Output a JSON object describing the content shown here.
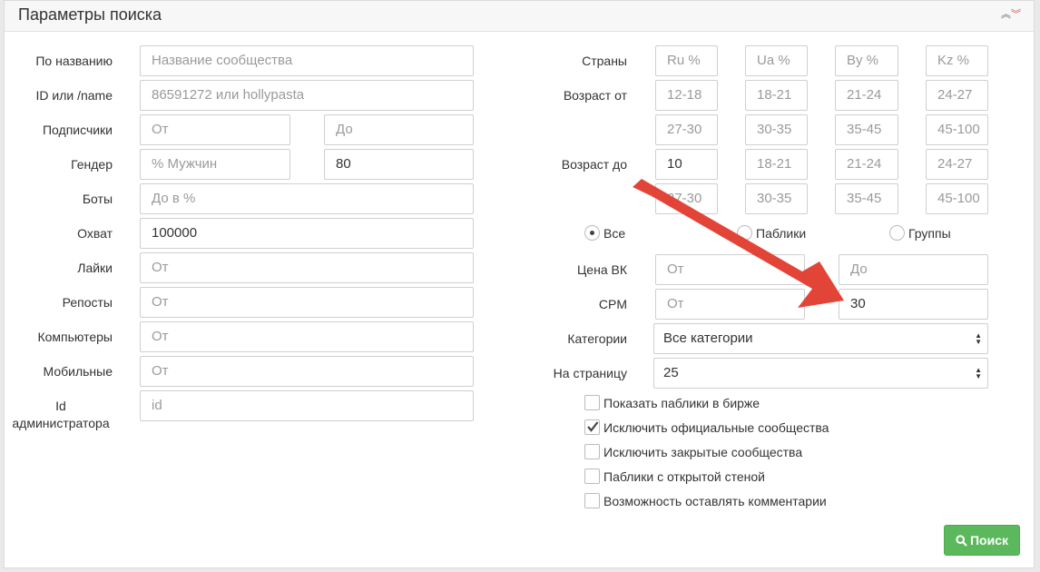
{
  "panel": {
    "title": "Параметры поиска"
  },
  "left": {
    "name_label": "По названию",
    "name_placeholder": "Название сообщества",
    "id_label": "ID или /name",
    "id_placeholder": "86591272 или hollypasta",
    "subs_label": "Подписчики",
    "subs_from": "От",
    "subs_to": "До",
    "gender_label": "Гендер",
    "gender_placeholder": "% Мужчин",
    "gender_value": "80",
    "bots_label": "Боты",
    "bots_placeholder": "До в %",
    "reach_label": "Охват",
    "reach_value": "100000",
    "likes_label": "Лайки",
    "likes_placeholder": "От",
    "reposts_label": "Репосты",
    "reposts_placeholder": "От",
    "computers_label": "Компьютеры",
    "computers_placeholder": "От",
    "mobile_label": "Мобильные",
    "mobile_placeholder": "От",
    "admin_label_1": "Id",
    "admin_label_2": "администратора",
    "admin_placeholder": "id"
  },
  "right": {
    "countries_label": "Страны",
    "countries": [
      "Ru %",
      "Ua %",
      "By %",
      "Kz %"
    ],
    "age_from_label": "Возраст от",
    "age_from_row1": [
      "12-18",
      "18-21",
      "21-24",
      "24-27"
    ],
    "age_from_row2": [
      "27-30",
      "30-35",
      "35-45",
      "45-100"
    ],
    "age_to_label": "Возраст до",
    "age_to_value": "10",
    "age_to_row1_rest": [
      "18-21",
      "21-24",
      "24-27"
    ],
    "age_to_row2": [
      "27-30",
      "30-35",
      "35-45",
      "45-100"
    ],
    "type_options": [
      "Все",
      "Паблики",
      "Группы"
    ],
    "price_label": "Цена ВК",
    "price_from": "От",
    "price_to": "До",
    "cpm_label": "CPM",
    "cpm_from": "От",
    "cpm_to_value": "30",
    "categories_label": "Категории",
    "categories_value": "Все категории",
    "per_page_label": "На страницу",
    "per_page_value": "25",
    "checkboxes": [
      "Показать паблики в бирже",
      "Исключить официальные сообщества",
      "Исключить закрытые сообщества",
      "Паблики с открытой стеной",
      "Возможность оставлять комментарии"
    ]
  },
  "search_button": {
    "label": "Поиск"
  },
  "colors": {
    "button": "#5cb85c",
    "arrow": "#e23a2d"
  }
}
